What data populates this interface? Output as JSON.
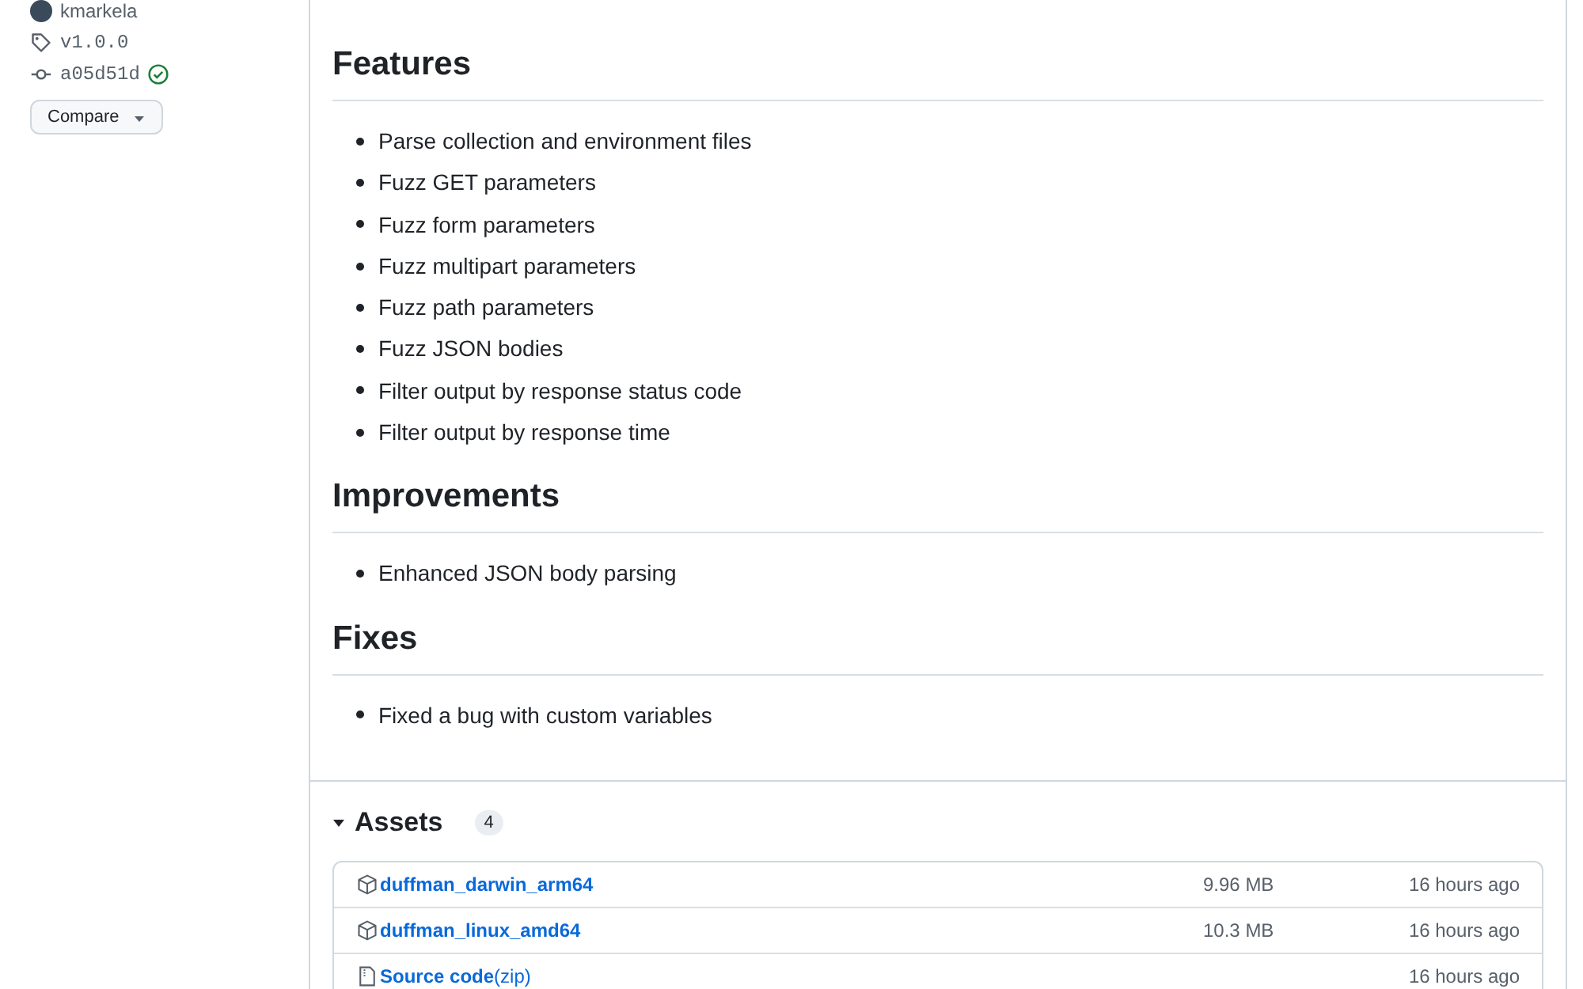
{
  "sidebar": {
    "author": "kmarkela",
    "tag": "v1.0.0",
    "commit": "a05d51d",
    "commit_verified": true,
    "compare_button": "Compare"
  },
  "release": {
    "sections": [
      {
        "heading": "Features",
        "items": [
          "Parse collection and environment files",
          "Fuzz GET parameters",
          "Fuzz form parameters",
          "Fuzz multipart parameters",
          "Fuzz path parameters",
          "Fuzz JSON bodies",
          "Filter output by response status code",
          "Filter output by response time"
        ]
      },
      {
        "heading": "Improvements",
        "items": [
          "Enhanced JSON body parsing"
        ]
      },
      {
        "heading": "Fixes",
        "items": [
          "Fixed a bug with custom variables"
        ]
      }
    ]
  },
  "assets": {
    "title": "Assets",
    "expanded": true,
    "count": "4",
    "rows": [
      {
        "kind": "binary",
        "name": "duffman_darwin_arm64",
        "size": "9.96 MB",
        "time": "16 hours ago"
      },
      {
        "kind": "binary",
        "name": "duffman_linux_amd64",
        "size": "10.3 MB",
        "time": "16 hours ago"
      },
      {
        "kind": "source",
        "name": "Source code",
        "suffix": "(zip)",
        "time": "16 hours ago"
      }
    ]
  }
}
